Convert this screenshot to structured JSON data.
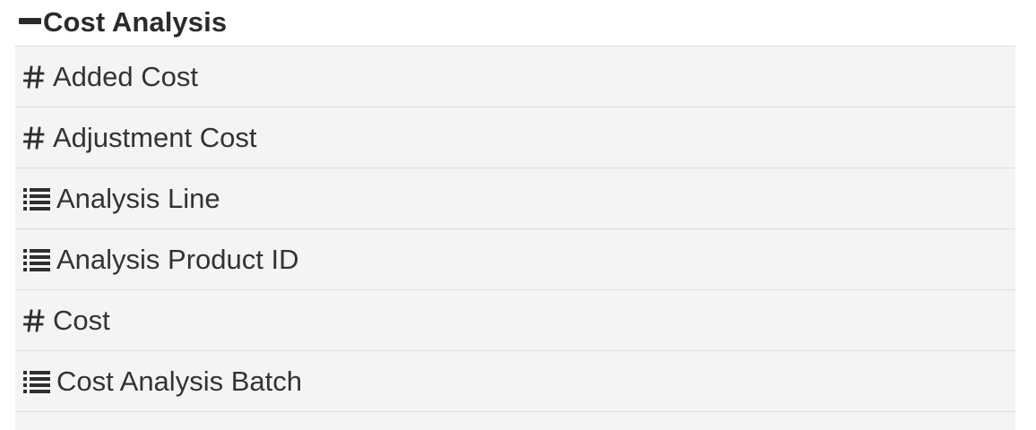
{
  "group": {
    "title": "Cost Analysis",
    "toggle_icon": "minus-icon",
    "fields": [
      {
        "label": "Added Cost",
        "icon": "hash-icon",
        "type": "number"
      },
      {
        "label": "Adjustment Cost",
        "icon": "hash-icon",
        "type": "number"
      },
      {
        "label": "Analysis Line",
        "icon": "list-icon",
        "type": "list"
      },
      {
        "label": "Analysis Product ID",
        "icon": "list-icon",
        "type": "list"
      },
      {
        "label": "Cost",
        "icon": "hash-icon",
        "type": "number"
      },
      {
        "label": "Cost Analysis Batch",
        "icon": "list-icon",
        "type": "list"
      }
    ]
  },
  "colors": {
    "row_background": "#f4f4f4",
    "row_border": "#dedede",
    "text": "#333333",
    "header_text": "#2b2b2b"
  }
}
